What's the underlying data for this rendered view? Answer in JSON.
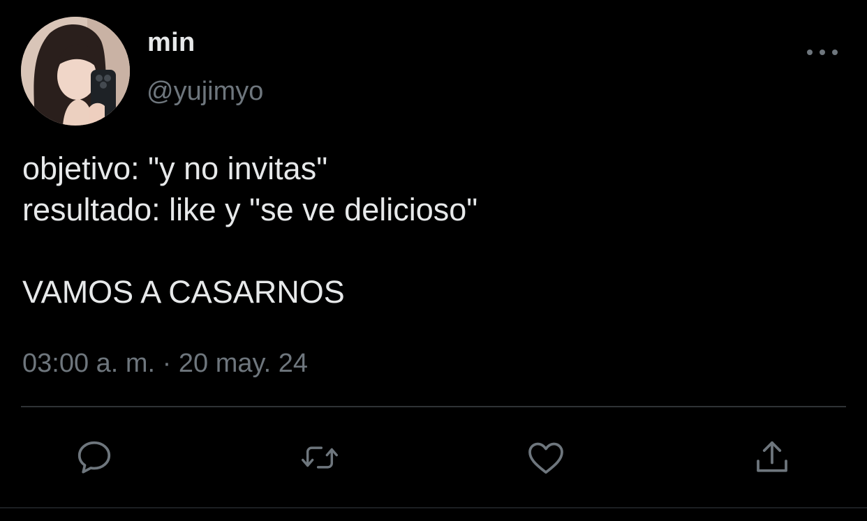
{
  "tweet": {
    "author": {
      "display_name": "min",
      "handle": "@yujimyo"
    },
    "text_lines": [
      "objetivo: \"y no invitas\"",
      "resultado: like y \"se ve delicioso\"",
      "",
      "VAMOS A CASARNOS"
    ],
    "timestamp": "03:00 a. m. · 20 may. 24"
  },
  "actions": [
    {
      "name": "reply",
      "icon": "reply-icon"
    },
    {
      "name": "retweet",
      "icon": "retweet-icon"
    },
    {
      "name": "like",
      "icon": "heart-icon"
    },
    {
      "name": "share",
      "icon": "share-icon"
    }
  ],
  "colors": {
    "background": "#000000",
    "primary_text": "#e7e9ea",
    "secondary_text": "#6e767d",
    "divider": "#2f3336"
  }
}
